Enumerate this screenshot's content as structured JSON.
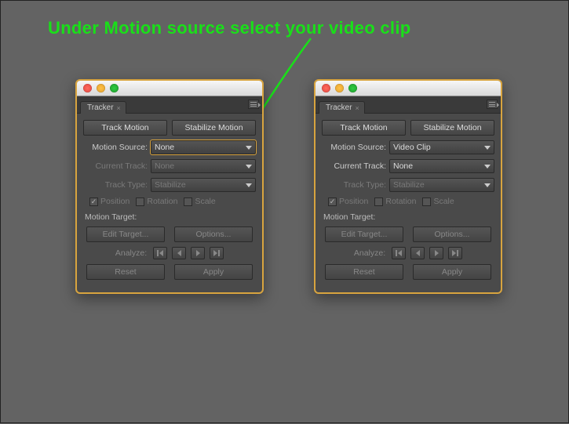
{
  "instruction": "Under Motion source select your video clip",
  "panel": {
    "tab_label": "Tracker",
    "track_motion": "Track Motion",
    "stabilize_motion": "Stabilize Motion",
    "motion_source_label": "Motion Source:",
    "current_track_label": "Current Track:",
    "track_type_label": "Track Type:",
    "position": "Position",
    "rotation": "Rotation",
    "scale": "Scale",
    "motion_target": "Motion Target:",
    "edit_target": "Edit Target...",
    "options": "Options...",
    "analyze": "Analyze:",
    "reset": "Reset",
    "apply": "Apply"
  },
  "left": {
    "motion_source_value": "None",
    "current_track_value": "None",
    "track_type_value": "Stabilize",
    "position_checked": true,
    "rotation_checked": false,
    "scale_checked": false,
    "current_track_enabled": false
  },
  "right": {
    "motion_source_value": "Video Clip",
    "current_track_value": "None",
    "track_type_value": "Stabilize",
    "position_checked": true,
    "rotation_checked": false,
    "scale_checked": false,
    "current_track_enabled": true
  }
}
